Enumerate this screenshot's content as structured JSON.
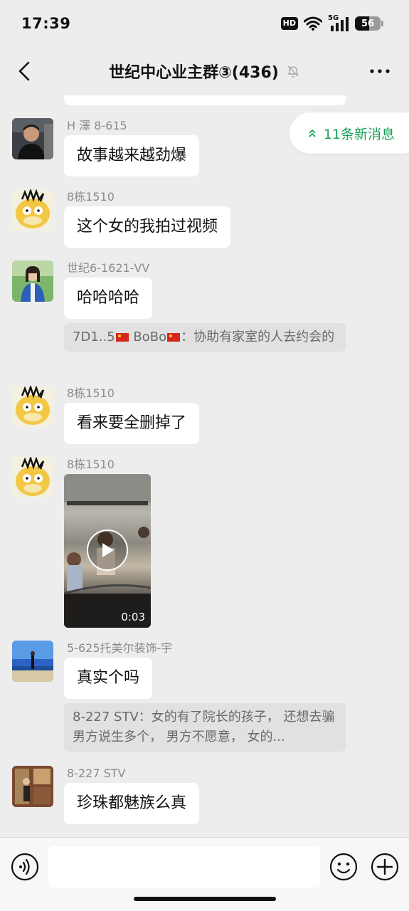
{
  "status_bar": {
    "time": "17:39",
    "hd_label": "HD",
    "network_label": "5G",
    "battery_level": "56",
    "icons": [
      "wifi-icon",
      "signal-icon",
      "battery-icon"
    ]
  },
  "header": {
    "title": "世纪中心业主群③(436)",
    "icons": {
      "back": "chevron-left-icon",
      "mute": "bell-muted-icon",
      "more": "more-dots-icon"
    }
  },
  "new_messages": {
    "label": "11条新消息",
    "icon": "double-chevron-up-icon",
    "color": "#1aa15a"
  },
  "messages": [
    {
      "sender": "H 澤 8-615",
      "text": "故事越来越劲爆"
    },
    {
      "sender": "8栋1510",
      "text": "这个女的我拍过视频"
    },
    {
      "sender": "世纪6-1621-VV",
      "text": "哈哈哈哈",
      "quote": {
        "prefix": "7D1..5",
        "name": "BoBo",
        "body": "：协助有家室的人去约会的"
      }
    },
    {
      "sender": "8栋1510",
      "text": "看来要全删掉了"
    },
    {
      "sender": "8栋1510",
      "video": {
        "duration": "0:03"
      }
    },
    {
      "sender": "5-625托美尔装饰-宇",
      "text": "真实个吗",
      "quote": {
        "body": "8-227 STV：女的有了院长的孩子， 还想去骗男方说生多个， 男方不愿意， 女的..."
      }
    },
    {
      "sender": "8-227 STV",
      "text": "珍珠都魅族么真"
    }
  ],
  "input_bar": {
    "icons": {
      "voice": "voice-icon",
      "emoji": "smiley-icon",
      "plus": "plus-circle-icon"
    }
  },
  "colors": {
    "background": "#ededed",
    "bubble": "#ffffff",
    "accent_green": "#1aa15a",
    "sender_gray": "#8c8c8c"
  }
}
